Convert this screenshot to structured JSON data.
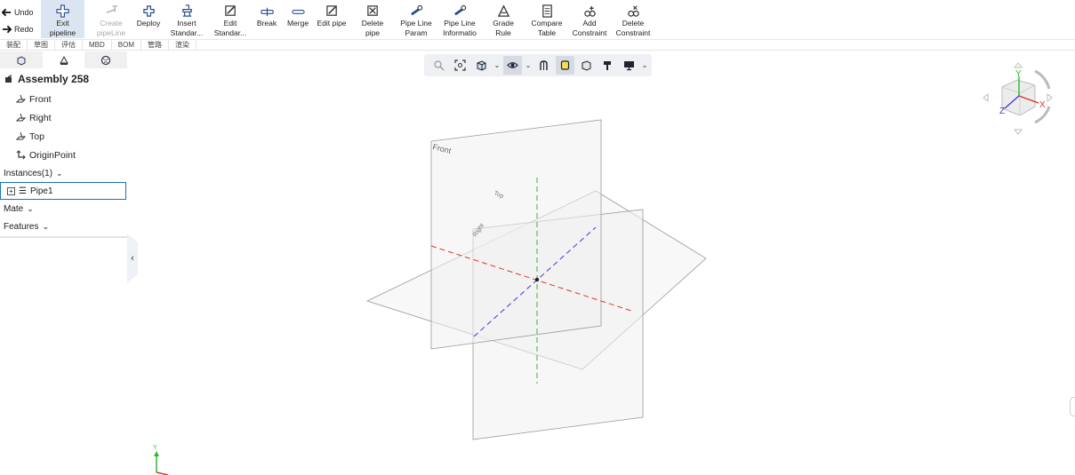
{
  "ribbon": {
    "undo": "Undo",
    "redo": "Redo",
    "tools": [
      {
        "label": "Exit\npipeline",
        "icon": "exit-pipeline-icon"
      },
      {
        "label": "Create\npipeLine",
        "icon": "create-pipeline-icon"
      },
      {
        "label": "Deploy",
        "icon": "deploy-icon"
      },
      {
        "label": "Insert\nStandar...",
        "icon": "insert-standard-icon"
      },
      {
        "label": "Edit\nStandar...",
        "icon": "edit-standard-icon"
      },
      {
        "label": "Break",
        "icon": "break-icon"
      },
      {
        "label": "Merge",
        "icon": "merge-icon"
      },
      {
        "label": "Edit pipe",
        "icon": "edit-pipe-icon"
      },
      {
        "label": "Delete\npipe",
        "icon": "delete-pipe-icon"
      },
      {
        "label": "Pipe Line\nParam",
        "icon": "pipe-line-param-icon"
      },
      {
        "label": "Pipe Line\nInformatio",
        "icon": "pipe-line-info-icon"
      },
      {
        "label": "Grade\nRule",
        "icon": "grade-rule-icon"
      },
      {
        "label": "Compare\nTable",
        "icon": "compare-table-icon"
      },
      {
        "label": "Add\nConstraint",
        "icon": "add-constraint-icon"
      },
      {
        "label": "Delete\nConstraint",
        "icon": "delete-constraint-icon"
      }
    ]
  },
  "subtabs": [
    "装配",
    "草图",
    "评估",
    "MBD",
    "BOM",
    "管路",
    "渲染"
  ],
  "panel": {
    "assembly_title": "Assembly 258",
    "items": [
      "Front",
      "Right",
      "Top",
      "OriginPoint"
    ],
    "instances_label": "Instances(1)",
    "instance": "Pipe1",
    "mate_label": "Mate",
    "features_label": "Features"
  },
  "viewport": {
    "plane_front": "Front",
    "plane_top": "Top",
    "plane_right": "Right",
    "triad_y": "Y",
    "cube_y": "Y",
    "cube_x": "X",
    "cube_z": "Z"
  },
  "colors": {
    "accent": "#1f6fb6",
    "x_axis": "#e0322d",
    "y_axis": "#2eb82e",
    "z_axis": "#3b3bd6",
    "active_tool": "#dbe5f1"
  }
}
